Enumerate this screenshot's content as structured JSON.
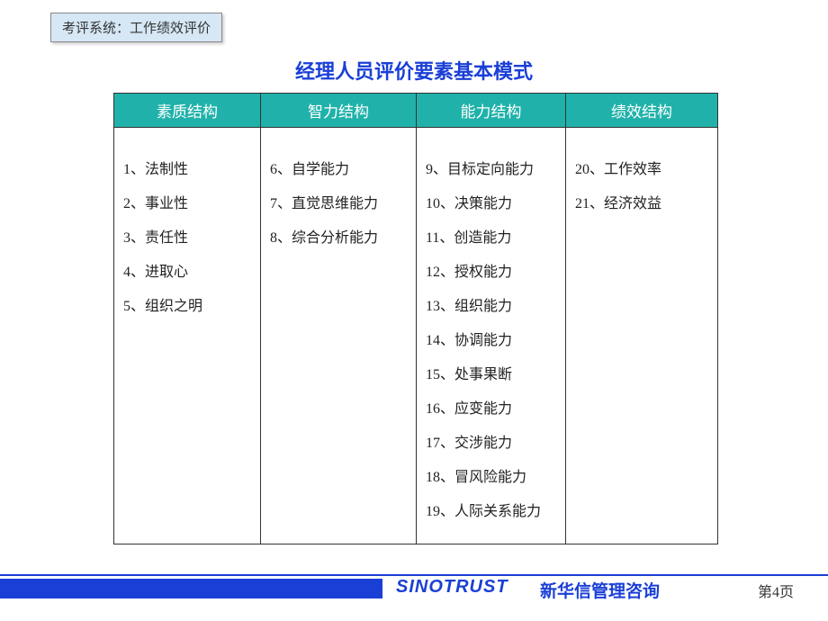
{
  "breadcrumb": "考评系统：工作绩效评价",
  "title": "经理人员评价要素基本模式",
  "columns": [
    {
      "header": "素质结构",
      "items": [
        "1、法制性",
        "2、事业性",
        "3、责任性",
        "4、进取心",
        "5、组织之明"
      ]
    },
    {
      "header": "智力结构",
      "items": [
        "6、自学能力",
        "7、直觉思维能力",
        "8、综合分析能力"
      ]
    },
    {
      "header": "能力结构",
      "items": [
        "9、目标定向能力",
        "10、决策能力",
        "11、创造能力",
        "12、授权能力",
        "13、组织能力",
        "14、协调能力",
        "15、处事果断",
        "16、应变能力",
        "17、交涉能力",
        "18、冒风险能力",
        "19、人际关系能力"
      ]
    },
    {
      "header": "绩效结构",
      "items": [
        "20、工作效率",
        "21、经济效益"
      ]
    }
  ],
  "footer": {
    "brand": "SINOTRUST",
    "company": "新华信管理咨询",
    "pageNumber": "第4页"
  }
}
